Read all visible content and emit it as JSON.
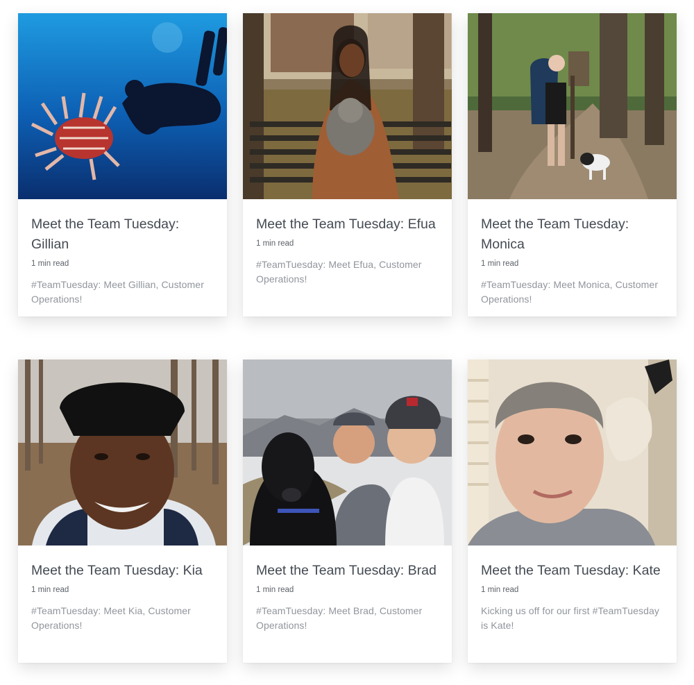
{
  "posts": [
    {
      "title": "Meet the Team Tuesday: Gillian",
      "read_time": "1 min read",
      "excerpt": "#TeamTuesday: Meet Gillian, Customer Operations!",
      "image_alt": "Diver underwater beside a lionfish"
    },
    {
      "title": "Meet the Team Tuesday: Efua",
      "read_time": "1 min read",
      "excerpt": "#TeamTuesday: Meet Efua, Customer Operations!",
      "image_alt": "Woman on a park bench holding a small dog"
    },
    {
      "title": "Meet the Team Tuesday: Monica",
      "read_time": "1 min read",
      "excerpt": "#TeamTuesday: Meet Monica, Customer Operations!",
      "image_alt": "Hiker with backpack and a dog on a forest trail"
    },
    {
      "title": "Meet the Team Tuesday: Kia",
      "read_time": "1 min read",
      "excerpt": "#TeamTuesday: Meet Kia, Customer Operations!",
      "image_alt": "Smiling selfie in a winter forest"
    },
    {
      "title": "Meet the Team Tuesday: Brad",
      "read_time": "1 min read",
      "excerpt": "#TeamTuesday: Meet Brad, Customer Operations!",
      "image_alt": "Couple and a black dog on a snowy mountain"
    },
    {
      "title": "Meet the Team Tuesday: Kate",
      "read_time": "1 min read",
      "excerpt": "Kicking us off for our first #TeamTuesday is Kate!",
      "image_alt": "Smiling selfie next to a mounted animal skull"
    }
  ]
}
